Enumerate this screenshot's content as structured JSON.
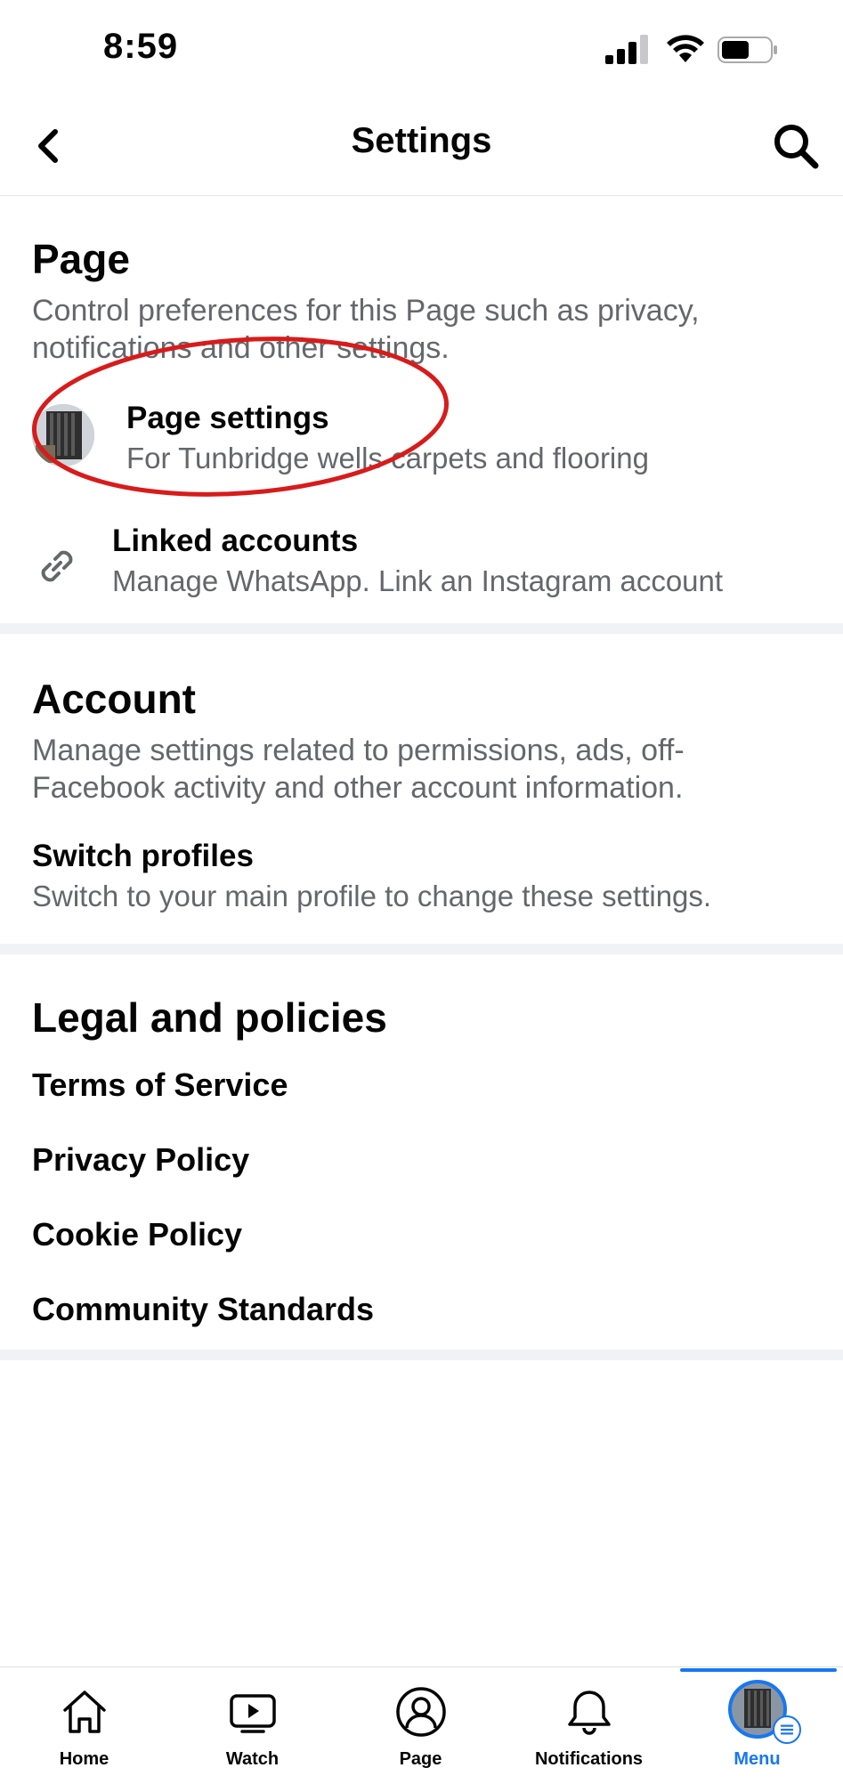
{
  "status_bar": {
    "time": "8:59"
  },
  "header": {
    "title": "Settings"
  },
  "page_section": {
    "title": "Page",
    "description": "Control preferences for this Page such as privacy, notifications and other settings.",
    "page_settings": {
      "title": "Page settings",
      "subtitle": "For Tunbridge wells carpets and flooring"
    },
    "linked_accounts": {
      "title": "Linked accounts",
      "subtitle": "Manage WhatsApp. Link an Instagram account"
    }
  },
  "account_section": {
    "title": "Account",
    "description": "Manage settings related to permissions, ads, off-Facebook activity and other account information.",
    "switch_profiles": {
      "title": "Switch profiles",
      "subtitle": "Switch to your main profile to change these settings."
    }
  },
  "legal_section": {
    "title": "Legal and policies",
    "links": [
      "Terms of Service",
      "Privacy Policy",
      "Cookie Policy",
      "Community Standards"
    ]
  },
  "tab_bar": {
    "tabs": [
      {
        "label": "Home",
        "icon": "home-icon"
      },
      {
        "label": "Watch",
        "icon": "watch-icon"
      },
      {
        "label": "Page",
        "icon": "page-icon"
      },
      {
        "label": "Notifications",
        "icon": "bell-icon"
      },
      {
        "label": "Menu",
        "icon": "menu-avatar",
        "active": true
      }
    ]
  },
  "colors": {
    "accent": "#1877f2",
    "secondary_text": "#65676b",
    "annotation": "#d81b1b"
  }
}
